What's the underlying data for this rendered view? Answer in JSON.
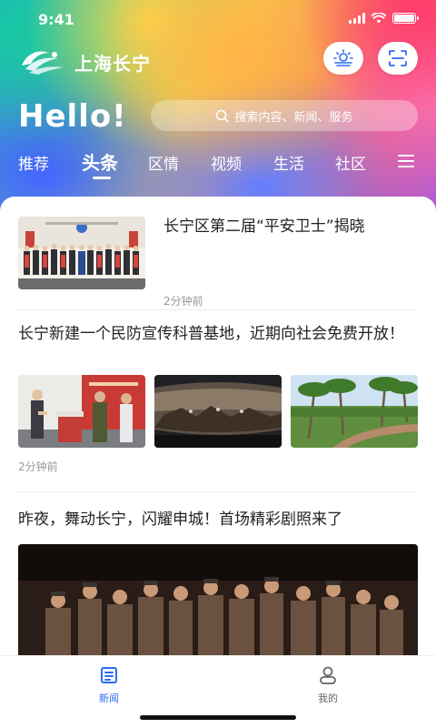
{
  "status_bar": {
    "time": "9:41",
    "battery_level": 1.0
  },
  "header": {
    "brand_name": "上海长宁",
    "greeting": "Hello!",
    "search_placeholder": "搜索内容、新闻、服务",
    "weather_icon": "weather-icon",
    "scan_icon": "scan-icon"
  },
  "tabs": [
    {
      "label": "推荐",
      "active": false
    },
    {
      "label": "头条",
      "active": true
    },
    {
      "label": "区情",
      "active": false
    },
    {
      "label": "视频",
      "active": false
    },
    {
      "label": "生活",
      "active": false
    },
    {
      "label": "社区",
      "active": false
    }
  ],
  "articles": [
    {
      "title": "长宁区第二届“平安卫士”揭晓",
      "time": "2分钟前"
    },
    {
      "title": "长宁新建一个民防宣传科普基地，近期向社会免费开放！",
      "time": "2分钟前"
    },
    {
      "title": "昨夜，舞动长宁，闪耀申城！首场精彩剧照来了"
    }
  ],
  "bottom_nav": [
    {
      "label": "新闻",
      "icon": "news-icon",
      "active": true
    },
    {
      "label": "我的",
      "icon": "user-icon",
      "active": false
    }
  ],
  "colors": {
    "accent": "#2b6bf2",
    "inactive": "#666666"
  }
}
